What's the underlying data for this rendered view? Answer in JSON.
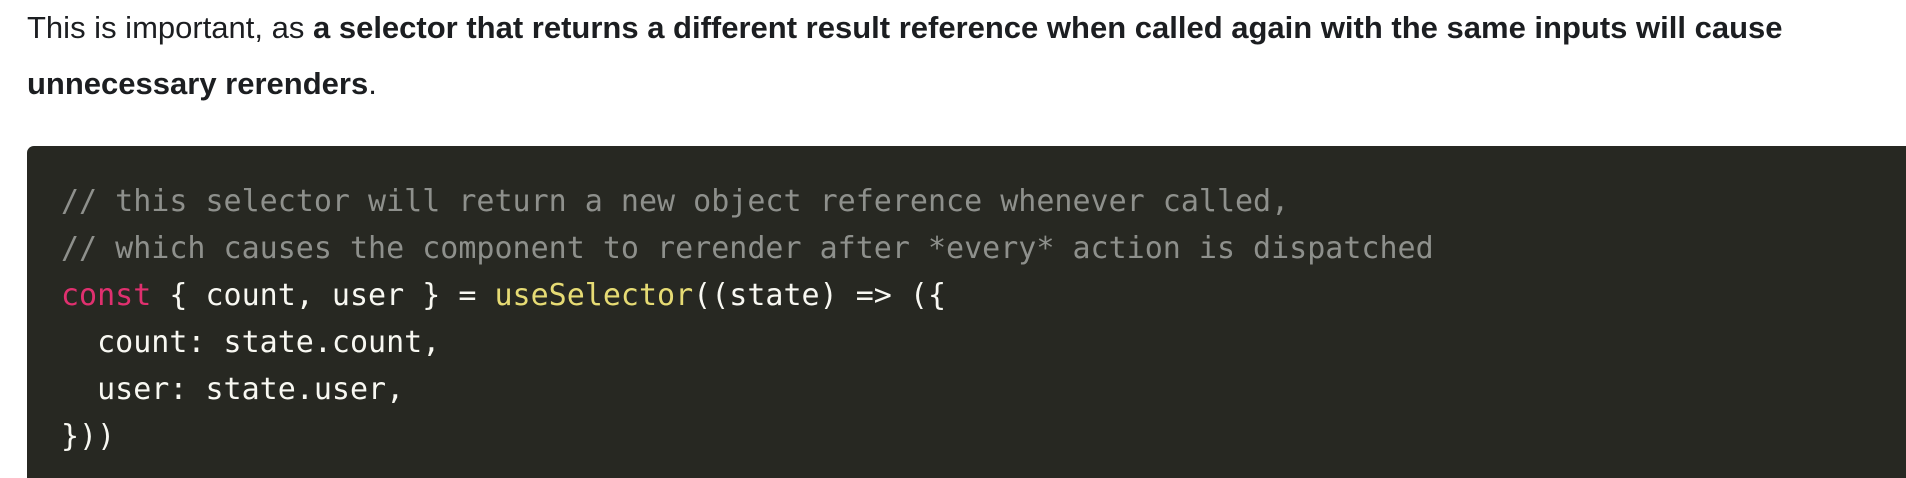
{
  "paragraph": {
    "prefix": "This is important, as ",
    "bold": "a selector that returns a different result reference when called again with the same inputs will cause unnecessary rerenders",
    "suffix": "."
  },
  "code": {
    "line1": "// this selector will return a new object reference whenever called,",
    "line2": "// which causes the component to rerender after *every* action is dispatched",
    "line3_keyword": "const",
    "line3_mid": " { count, user } = ",
    "line3_func": "useSelector",
    "line3_end": "((state) => ({",
    "line4": "  count: state.count,",
    "line5": "  user: state.user,",
    "line6": "}))"
  },
  "colors": {
    "code_background": "#272822",
    "comment": "#8e908c",
    "keyword": "#e0306f",
    "function": "#e6db74",
    "code_text": "#f8f8f2"
  }
}
